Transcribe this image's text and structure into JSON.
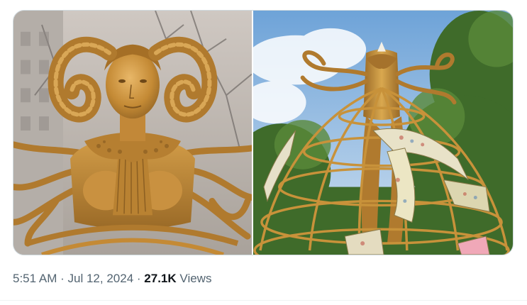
{
  "media": {
    "photos": [
      {
        "alt": ""
      },
      {
        "alt": ""
      }
    ]
  },
  "meta": {
    "time": "5:51 AM",
    "separator_1": "·",
    "date": "Jul 12, 2024",
    "separator_2": "·",
    "views_count": "27.1K",
    "views_label": "Views"
  },
  "colors": {
    "meta_text": "#536471",
    "count_text": "#0f1419",
    "border": "#cfd9de",
    "gold": "#c8923a"
  }
}
